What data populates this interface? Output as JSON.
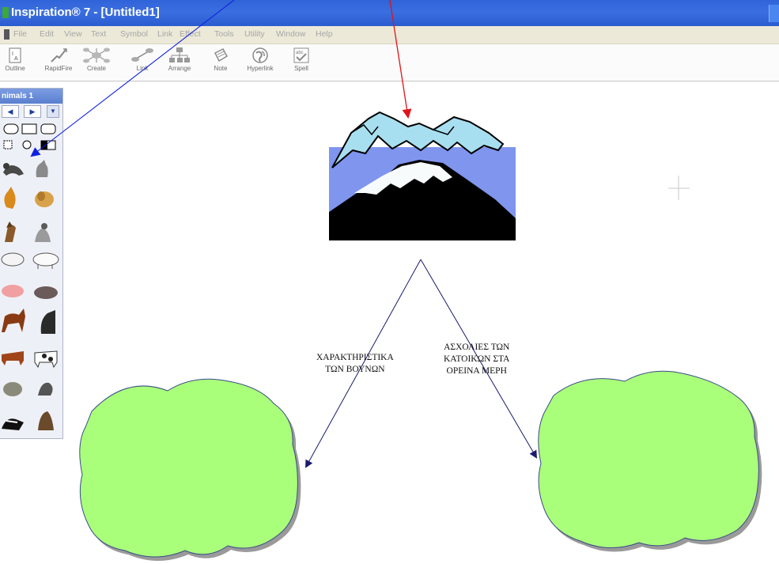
{
  "window": {
    "title": "Inspiration® 7 - [Untitled1]"
  },
  "menu": {
    "items": [
      "File",
      "Edit",
      "View",
      "Text",
      "Symbol",
      "Link",
      "Effect",
      "Tools",
      "Utility",
      "Window",
      "Help"
    ]
  },
  "toolbar": {
    "buttons": [
      {
        "label": "Outline",
        "icon": "outline-icon"
      },
      {
        "label": "RapidFire",
        "icon": "rapidfire-icon"
      },
      {
        "label": "Create",
        "icon": "create-icon"
      },
      {
        "label": "Link",
        "icon": "link-icon"
      },
      {
        "label": "Arrange",
        "icon": "arrange-icon"
      },
      {
        "label": "Note",
        "icon": "note-icon"
      },
      {
        "label": "Hyperlink",
        "icon": "hyperlink-icon"
      },
      {
        "label": "Spell",
        "icon": "spell-icon"
      }
    ]
  },
  "palette": {
    "title": "nimals 1",
    "nav_prev": "◀",
    "nav_next": "▶",
    "nav_menu": "▼"
  },
  "diagram": {
    "main_symbol": "mountain-icon",
    "link_labels": {
      "left_line1": "ΧΑΡΑΚΤΗΡΙΣΤΙΚΑ",
      "left_line2": "ΤΩΝ ΒΟΥΝΩΝ",
      "right_line1": "ΑΣΧΟΛΙΕΣ ΤΩΝ",
      "right_line2": "ΚΑΤΟΙΚΩΝ ΣΤΑ",
      "right_line3": "ΟΡΕΙΝΑ ΜΕΡΗ"
    },
    "cloud_fill": "#aaff7a",
    "cloud_shadow": "#9a9a9a",
    "link_color": "#1a1a6e"
  },
  "annotations": {
    "red_arrow_color": "#e0141a",
    "blue_arrow_color": "#1020e0"
  }
}
